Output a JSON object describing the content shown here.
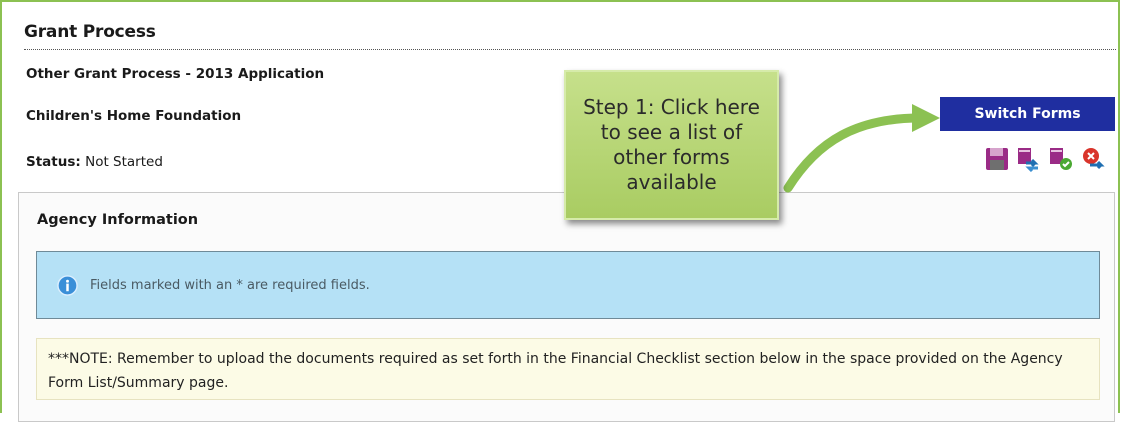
{
  "page_title": "Grant Process",
  "subtitle": "Other Grant Process - 2013 Application",
  "organization": "Children's Home Foundation",
  "status": {
    "label": "Status:",
    "value": "Not Started"
  },
  "switch_forms_label": "Switch Forms",
  "action_icons": [
    "save-icon",
    "form-swap-icon",
    "form-submit-icon",
    "undo-icon"
  ],
  "panel": {
    "title": "Agency Information",
    "info_text": "Fields marked with an * are required fields.",
    "note": "***NOTE: Remember to upload the documents required as set forth in the Financial Checklist section below in the space provided on the Agency Form List/Summary page."
  },
  "callout": {
    "text": "Step 1: Click here to see a list of other forms available"
  },
  "colors": {
    "frame": "#8cc152",
    "button": "#1f2ea0",
    "info_bg": "#b5e1f6",
    "note_bg": "#fcfbe6",
    "callout": "#b3d46f"
  }
}
